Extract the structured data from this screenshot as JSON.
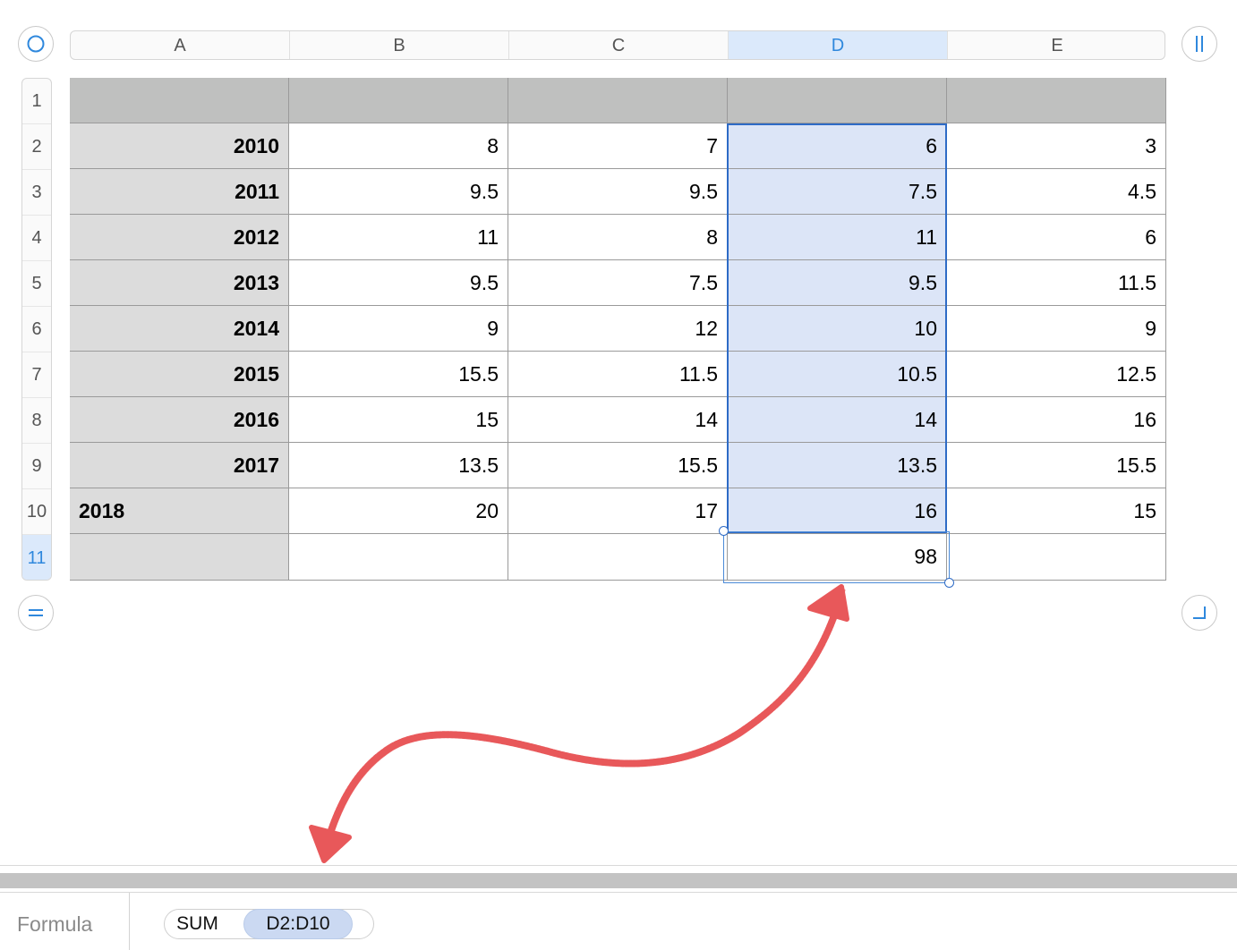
{
  "columns": [
    "A",
    "B",
    "C",
    "D",
    "E"
  ],
  "selected_column": "D",
  "rows": [
    "1",
    "2",
    "3",
    "4",
    "5",
    "6",
    "7",
    "8",
    "9",
    "10",
    "11"
  ],
  "selected_row": "11",
  "table": {
    "row_1": [
      "",
      "",
      "",
      "",
      ""
    ],
    "body": [
      [
        "2010",
        "8",
        "7",
        "6",
        "3"
      ],
      [
        "2011",
        "9.5",
        "9.5",
        "7.5",
        "4.5"
      ],
      [
        "2012",
        "11",
        "8",
        "11",
        "6"
      ],
      [
        "2013",
        "9.5",
        "7.5",
        "9.5",
        "11.5"
      ],
      [
        "2014",
        "9",
        "12",
        "10",
        "9"
      ],
      [
        "2015",
        "15.5",
        "11.5",
        "10.5",
        "12.5"
      ],
      [
        "2016",
        "15",
        "14",
        "14",
        "16"
      ],
      [
        "2017",
        "13.5",
        "15.5",
        "13.5",
        "15.5"
      ],
      [
        "2018",
        "20",
        "17",
        "16",
        "15"
      ]
    ],
    "row_11": [
      "",
      "",
      "",
      "98",
      ""
    ]
  },
  "formula": {
    "label": "Formula",
    "function": "SUM",
    "argument": "D2:D10"
  },
  "colors": {
    "selection": "#2e6bc6",
    "selection_fill": "#dce5f7",
    "annotation_arrow": "#e8585a"
  },
  "icons": {
    "select_all": "circle-icon",
    "freeze_columns": "double-bar-icon",
    "freeze_rows": "double-line-icon",
    "resize_table": "corner-icon"
  }
}
